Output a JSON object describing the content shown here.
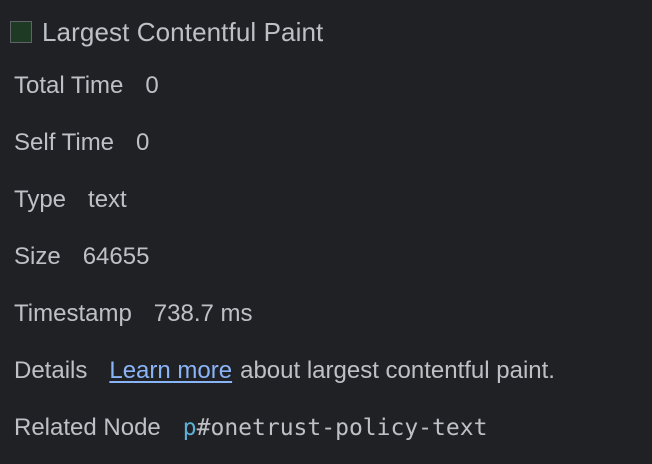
{
  "header": {
    "swatch_color": "#1f3a24",
    "swatch_border": "#5f6368",
    "title": "Largest Contentful Paint"
  },
  "details": {
    "total_time": {
      "label": "Total Time",
      "value": "0"
    },
    "self_time": {
      "label": "Self Time",
      "value": "0"
    },
    "type": {
      "label": "Type",
      "value": "text"
    },
    "size": {
      "label": "Size",
      "value": "64655"
    },
    "timestamp": {
      "label": "Timestamp",
      "value": "738.7 ms"
    },
    "details_row": {
      "label": "Details",
      "link_text": "Learn more",
      "after_text": "about largest contentful paint."
    },
    "related_node": {
      "label": "Related Node",
      "tag": "p",
      "id": "#onetrust-policy-text"
    }
  },
  "colors": {
    "background": "#202124",
    "text": "#bdc1c6",
    "link": "#8ab4f8",
    "node_tag": "#5db0d7"
  }
}
